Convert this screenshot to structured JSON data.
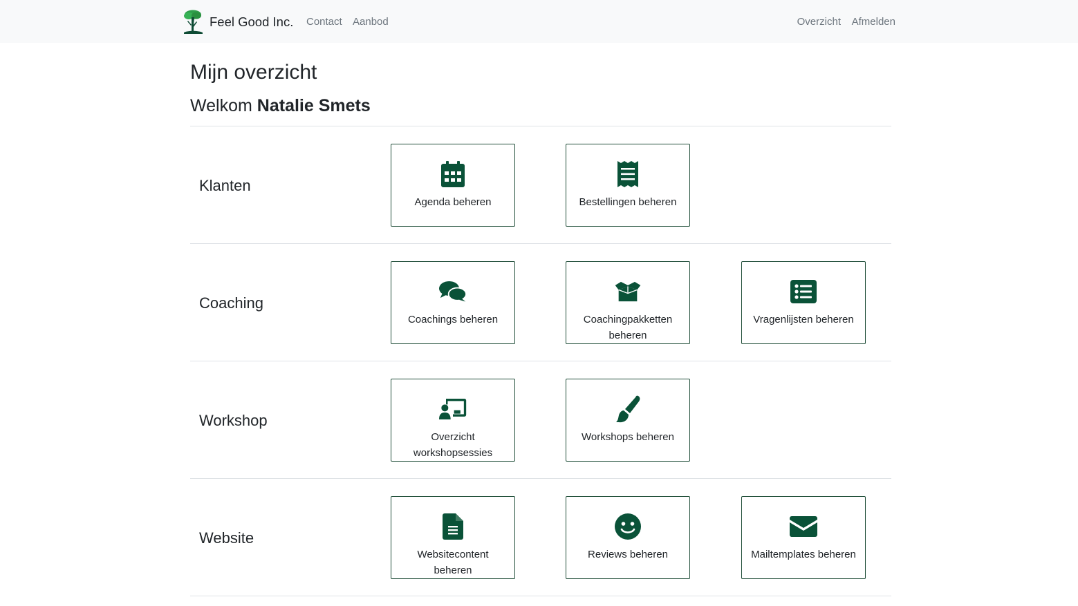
{
  "navbar": {
    "brand": "Feel Good Inc.",
    "links_left": [
      "Contact",
      "Aanbod"
    ],
    "links_right": [
      "Overzicht",
      "Afmelden"
    ]
  },
  "page": {
    "title": "Mijn overzicht",
    "welcome_prefix": "Welkom ",
    "user_name": "Natalie Smets"
  },
  "accent_color": "#0a5238",
  "sections": [
    {
      "label": "Klanten",
      "tiles": [
        {
          "label": "Agenda beheren",
          "icon": "calendar-icon"
        },
        {
          "label": "Bestellingen beheren",
          "icon": "receipt-icon"
        }
      ]
    },
    {
      "label": "Coaching",
      "tiles": [
        {
          "label": "Coachings beheren",
          "icon": "comments-icon"
        },
        {
          "label": "Coachingpakketten beheren",
          "icon": "open-box-icon"
        },
        {
          "label": "Vragenlijsten beheren",
          "icon": "list-icon"
        }
      ]
    },
    {
      "label": "Workshop",
      "tiles": [
        {
          "label": "Overzicht workshopsessies",
          "icon": "chalkboard-user-icon"
        },
        {
          "label": "Workshops beheren",
          "icon": "paintbrush-icon"
        }
      ]
    },
    {
      "label": "Website",
      "tiles": [
        {
          "label": "Websitecontent beheren",
          "icon": "file-lines-icon"
        },
        {
          "label": "Reviews beheren",
          "icon": "smile-icon"
        },
        {
          "label": "Mailtemplates beheren",
          "icon": "envelope-icon"
        }
      ]
    }
  ]
}
